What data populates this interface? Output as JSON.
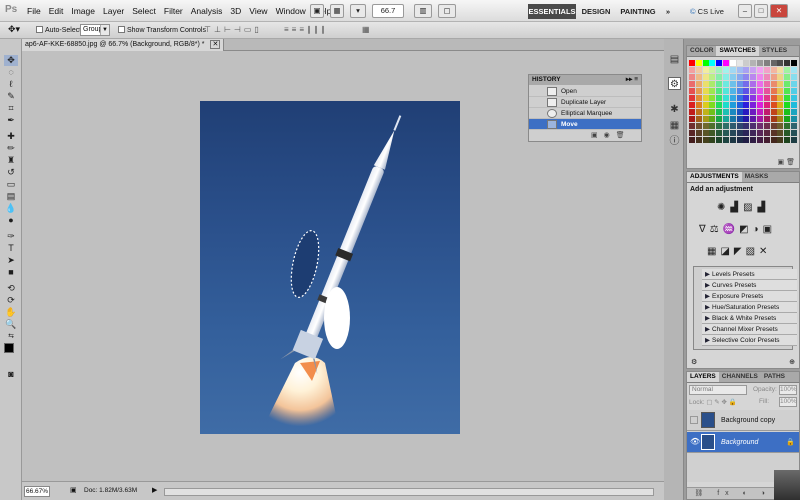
{
  "app": {
    "logo": "Ps",
    "menus": [
      "File",
      "Edit",
      "Image",
      "Layer",
      "Select",
      "Filter",
      "Analysis",
      "3D",
      "View",
      "Window",
      "Help"
    ],
    "zoom_value": "66.7",
    "workspaces": [
      "ESSENTIALS",
      "DESIGN",
      "PAINTING"
    ],
    "more": "»",
    "cs_live": "CS Live"
  },
  "options": {
    "auto_select_label": "Auto-Select:",
    "auto_select_value": "Group",
    "show_transform_label": "Show Transform Controls"
  },
  "document": {
    "tab_title": "ap6-AF-KKE-68850.jpg @ 66.7% (Background, RGB/8*) *"
  },
  "status": {
    "zoom": "66.67%",
    "doc": "Doc: 1.82M/3.63M"
  },
  "history": {
    "title": "HISTORY",
    "items": [
      "Open",
      "Duplicate Layer",
      "Elliptical Marquee",
      "Move"
    ],
    "active_index": 3
  },
  "color_panel": {
    "tabs": [
      "COLOR",
      "SWATCHES",
      "STYLES"
    ],
    "active": "SWATCHES"
  },
  "adjustments": {
    "tabs": [
      "ADJUSTMENTS",
      "MASKS"
    ],
    "header": "Add an adjustment",
    "presets": [
      "Levels Presets",
      "Curves Presets",
      "Exposure Presets",
      "Hue/Saturation Presets",
      "Black & White Presets",
      "Channel Mixer Presets",
      "Selective Color Presets"
    ]
  },
  "layers": {
    "tabs": [
      "LAYERS",
      "CHANNELS",
      "PATHS"
    ],
    "blend_mode": "Normal",
    "opacity_label": "Opacity:",
    "opacity_value": "100%",
    "lock_label": "Lock:",
    "fill_label": "Fill:",
    "fill_value": "100%",
    "items": [
      "Background copy",
      "Background"
    ],
    "active_index": 1
  },
  "colors": {
    "accent": "#3d6fc4",
    "panel": "#d6d6d6"
  }
}
